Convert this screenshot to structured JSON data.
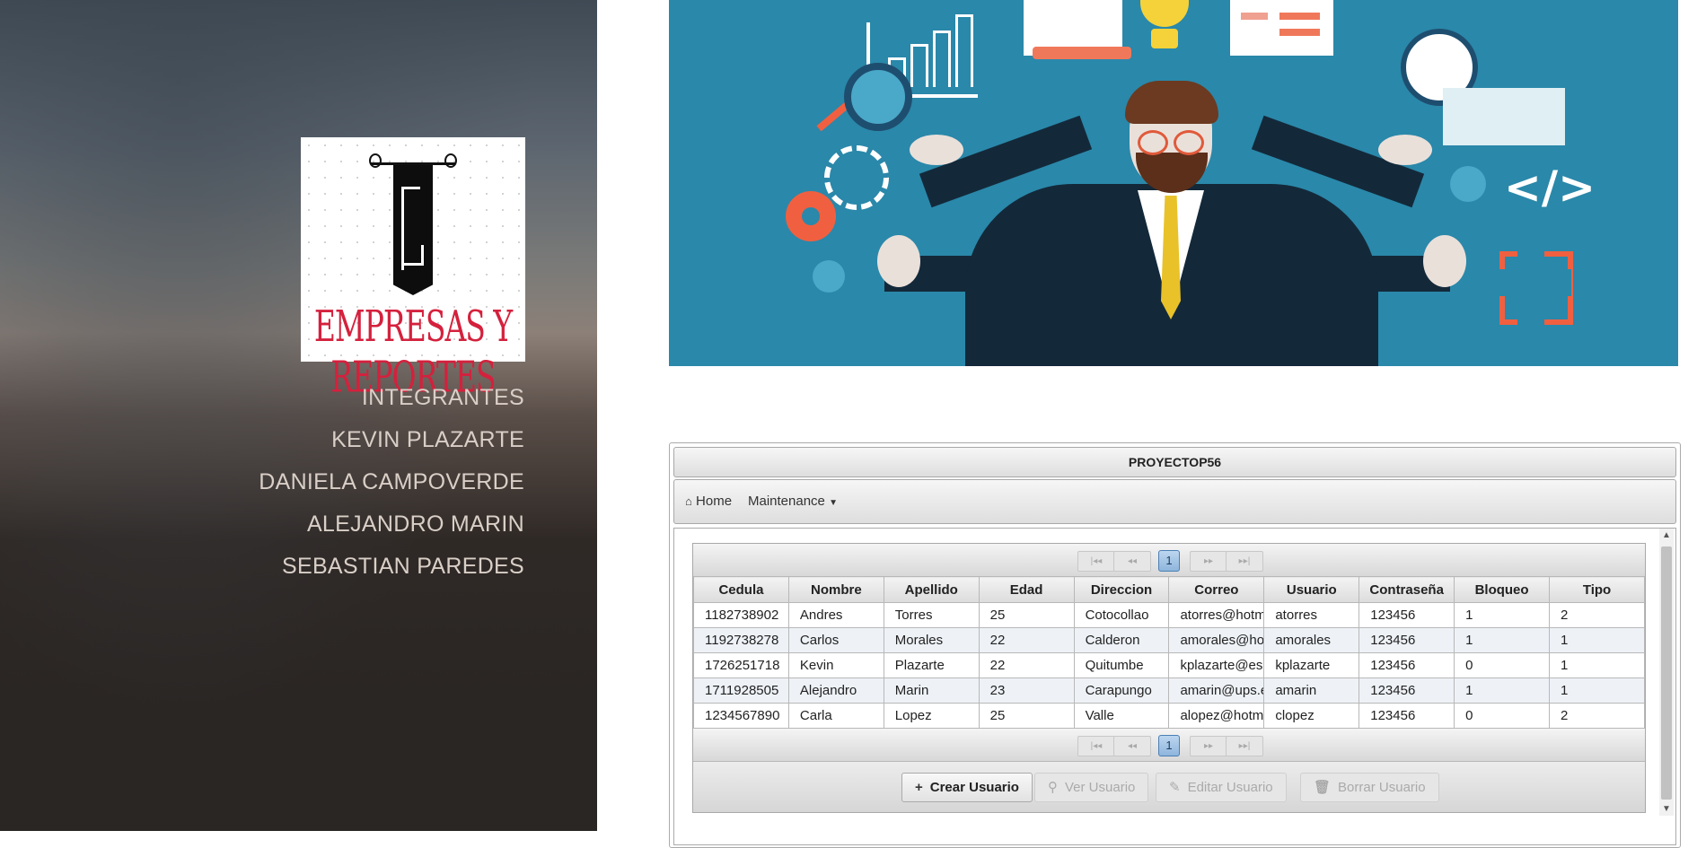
{
  "sidebar": {
    "logo_text": "EMPRESAS Y REPORTES",
    "nav": [
      {
        "label": "INTEGRANTES"
      },
      {
        "label": "KEVIN PLAZARTE"
      },
      {
        "label": "DANIELA CAMPOVERDE"
      },
      {
        "label": "ALEJANDRO MARIN"
      },
      {
        "label": "SEBASTIAN PAREDES"
      }
    ]
  },
  "app": {
    "title": "PROYECTOP56",
    "menu": {
      "home_label": "Home",
      "maintenance_label": "Maintenance"
    },
    "paginator": {
      "current_page": "1",
      "first_icon": "first-page-icon",
      "prev_icon": "prev-page-icon",
      "next_icon": "next-page-icon",
      "last_icon": "last-page-icon"
    },
    "table": {
      "columns": [
        "Cedula",
        "Nombre",
        "Apellido",
        "Edad",
        "Direccion",
        "Correo",
        "Usuario",
        "Contraseña",
        "Bloqueo",
        "Tipo"
      ],
      "rows": [
        [
          "1182738902",
          "Andres",
          "Torres",
          "25",
          "Cotocollao",
          "atorres@hotm",
          "atorres",
          "123456",
          "1",
          "2"
        ],
        [
          "1192738278",
          "Carlos",
          "Morales",
          "22",
          "Calderon",
          "amorales@ho",
          "amorales",
          "123456",
          "1",
          "1"
        ],
        [
          "1726251718",
          "Kevin",
          "Plazarte",
          "22",
          "Quitumbe",
          "kplazarte@es",
          "kplazarte",
          "123456",
          "0",
          "1"
        ],
        [
          "1711928505",
          "Alejandro",
          "Marin",
          "23",
          "Carapungo",
          "amarin@ups.e",
          "amarin",
          "123456",
          "1",
          "1"
        ],
        [
          "1234567890",
          "Carla",
          "Lopez",
          "25",
          "Valle",
          "alopez@hotm",
          "clopez",
          "123456",
          "0",
          "2"
        ]
      ]
    },
    "buttons": {
      "create": "Crear Usuario",
      "view": "Ver Usuario",
      "edit": "Editar Usuario",
      "delete": "Borrar Usuario"
    }
  },
  "colors": {
    "sidebar_text": "#d9cfc7",
    "logo_red": "#d4213d",
    "hero_bg": "#2a88aa"
  }
}
